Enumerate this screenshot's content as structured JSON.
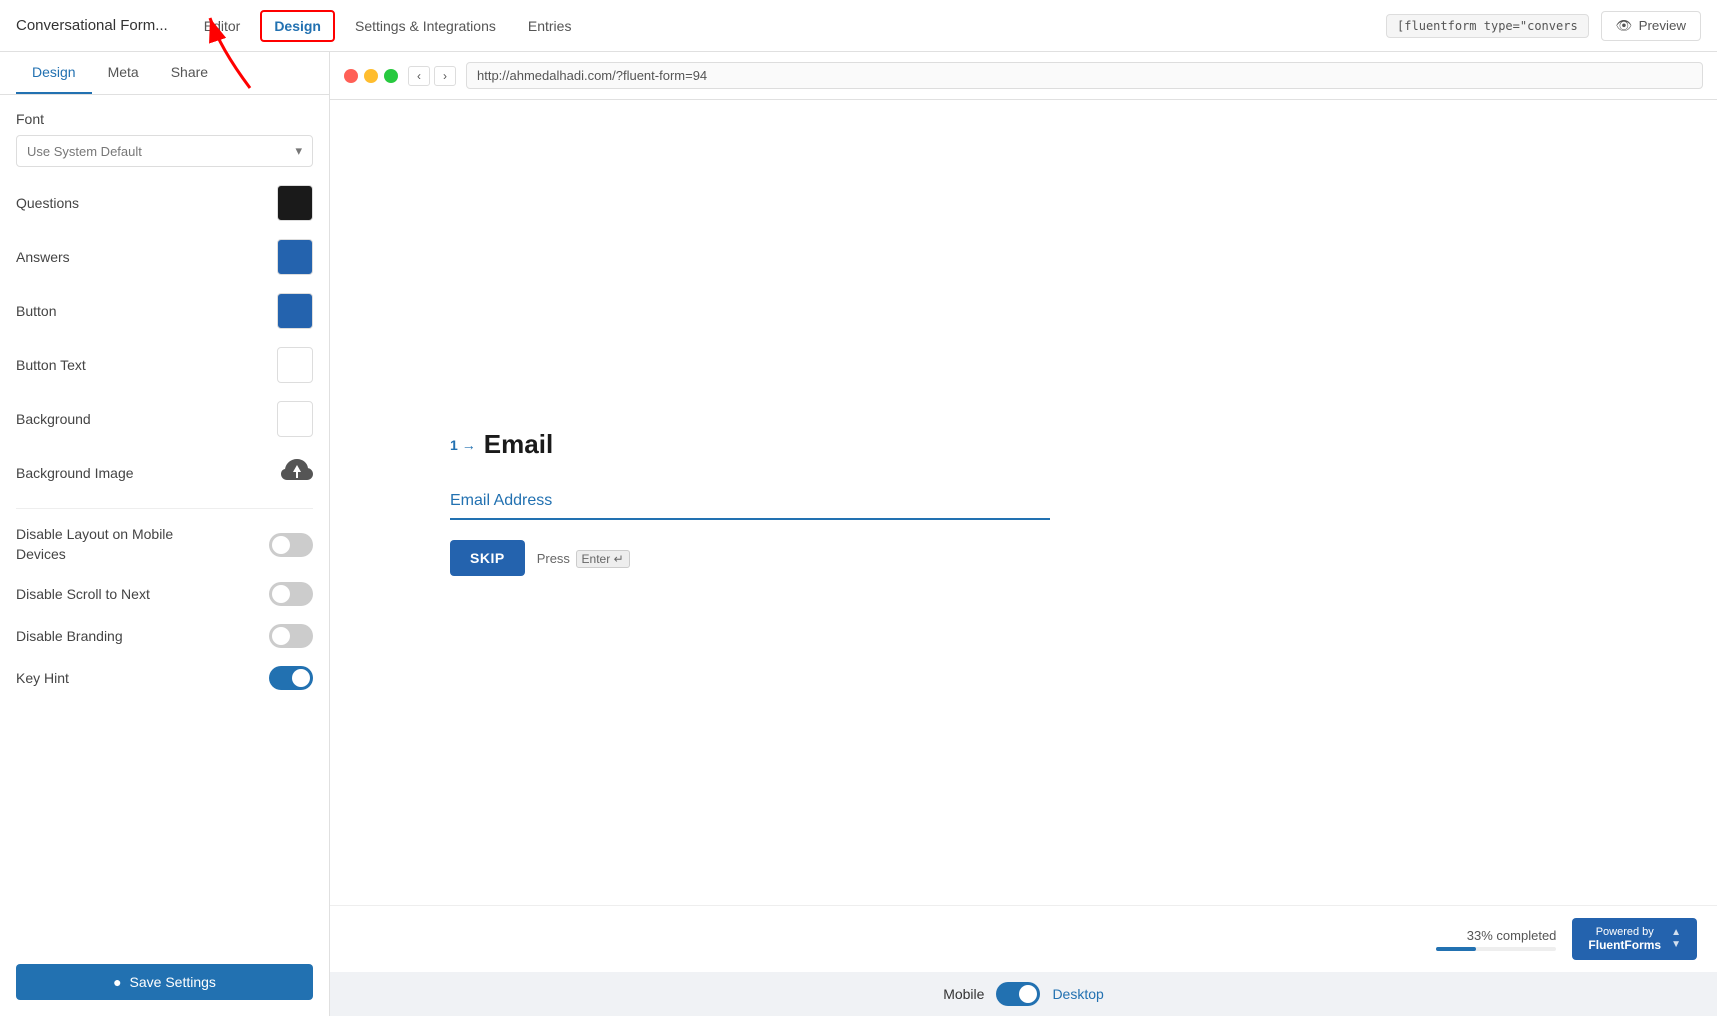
{
  "app": {
    "brand": "Conversational Form...",
    "nav_items": [
      {
        "id": "editor",
        "label": "Editor",
        "active": false
      },
      {
        "id": "design",
        "label": "Design",
        "active": true
      },
      {
        "id": "settings",
        "label": "Settings & Integrations",
        "active": false
      },
      {
        "id": "entries",
        "label": "Entries",
        "active": false
      }
    ],
    "code_badge": "[fluentform type=\"convers",
    "preview_btn": "Preview"
  },
  "left_panel": {
    "tabs": [
      {
        "id": "design",
        "label": "Design",
        "active": true
      },
      {
        "id": "meta",
        "label": "Meta",
        "active": false
      },
      {
        "id": "share",
        "label": "Share",
        "active": false
      }
    ],
    "font_label": "Font",
    "font_placeholder": "Use System Default",
    "settings": [
      {
        "id": "questions",
        "label": "Questions",
        "type": "color",
        "color": "black"
      },
      {
        "id": "answers",
        "label": "Answers",
        "type": "color",
        "color": "blue"
      },
      {
        "id": "button",
        "label": "Button",
        "type": "color",
        "color": "blue"
      },
      {
        "id": "button_text",
        "label": "Button Text",
        "type": "color",
        "color": "white"
      },
      {
        "id": "background",
        "label": "Background",
        "type": "color",
        "color": "white"
      },
      {
        "id": "background_image",
        "label": "Background Image",
        "type": "upload"
      },
      {
        "id": "disable_layout",
        "label": "Disable Layout on Mobile Devices",
        "type": "toggle",
        "value": false
      },
      {
        "id": "disable_scroll",
        "label": "Disable Scroll to Next",
        "type": "toggle",
        "value": false
      },
      {
        "id": "disable_branding",
        "label": "Disable Branding",
        "type": "toggle",
        "value": false
      },
      {
        "id": "key_hint",
        "label": "Key Hint",
        "type": "toggle",
        "value": true
      }
    ],
    "save_btn": "Save Settings"
  },
  "browser": {
    "url": "http://ahmedalhadi.com/?fluent-form=94"
  },
  "form_preview": {
    "question_num": "1",
    "question_arrow": "→",
    "question_label": "Email",
    "email_placeholder": "Email Address",
    "skip_btn": "SKIP",
    "press_label": "Press",
    "enter_label": "Enter",
    "enter_symbol": "↵"
  },
  "form_bottom": {
    "progress_pct": "33% completed",
    "powered_line1": "Powered by",
    "powered_line2": "FluentForms"
  },
  "view_toggle": {
    "mobile_label": "Mobile",
    "desktop_label": "Desktop"
  }
}
